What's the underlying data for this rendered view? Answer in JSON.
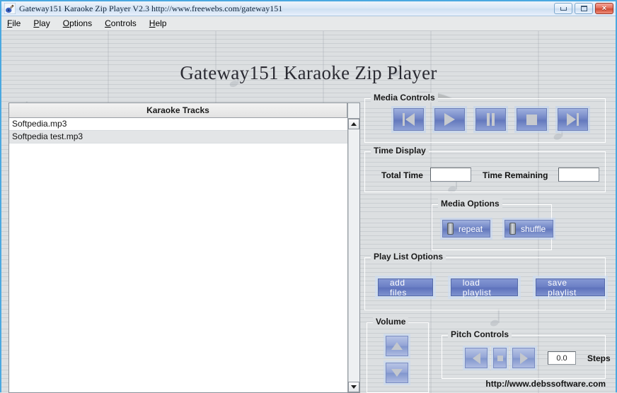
{
  "window": {
    "titlebar": {
      "icon": "guitar-icon",
      "title": "Gateway151 Karaoke Zip Player V2.3   http://www.freewebs.com/gateway151",
      "minimize_label": "Minimize",
      "maximize_label": "Maximize",
      "close_label": "×"
    },
    "menubar": {
      "items": [
        {
          "mnemonic": "F",
          "rest": "ile"
        },
        {
          "mnemonic": "P",
          "rest": "lay"
        },
        {
          "mnemonic": "O",
          "rest": "ptions"
        },
        {
          "mnemonic": "C",
          "rest": "ontrols"
        },
        {
          "mnemonic": "H",
          "rest": "elp"
        }
      ]
    }
  },
  "app_title": "Gateway151 Karaoke Zip Player",
  "tracklist": {
    "header": "Karaoke Tracks",
    "rows": [
      {
        "name": "Softpedia.mp3"
      },
      {
        "name": "Softpedia test.mp3"
      }
    ],
    "scrollbar": {
      "up": "scroll-up",
      "down": "scroll-down"
    }
  },
  "media_controls": {
    "legend": "Media Controls",
    "buttons": [
      {
        "name": "previous",
        "glyph": "previous-icon"
      },
      {
        "name": "play",
        "glyph": "play-icon"
      },
      {
        "name": "pause",
        "glyph": "pause-icon"
      },
      {
        "name": "stop",
        "glyph": "stop-icon"
      },
      {
        "name": "next",
        "glyph": "next-icon"
      }
    ]
  },
  "time_display": {
    "legend": "Time Display",
    "total_time_label": "Total Time",
    "total_time_value": "",
    "time_remaining_label": "Time Remaining",
    "time_remaining_value": ""
  },
  "media_options": {
    "legend": "Media Options",
    "repeat_label": "repeat",
    "shuffle_label": "shuffle"
  },
  "playlist_options": {
    "legend": "Play List Options",
    "add_files_label": "add  files",
    "load_playlist_label": "load  playlist",
    "save_playlist_label": "save playlist"
  },
  "volume": {
    "legend": "Volume",
    "up_label": "volume-up",
    "down_label": "volume-down"
  },
  "pitch_controls": {
    "legend": "Pitch Controls",
    "down_label": "pitch-down",
    "reset_label": "pitch-reset",
    "up_label": "pitch-up",
    "steps_value": "0.0",
    "steps_label": "Steps"
  },
  "footer": {
    "url": "http://www.debssoftware.com"
  },
  "colors": {
    "accent_blue": "#6d81c6",
    "titlebar_blue": "#cfe0f2",
    "window_border": "#4aa8e0",
    "client_bg": "#dcdfe1",
    "close_red": "#cf4a33"
  }
}
